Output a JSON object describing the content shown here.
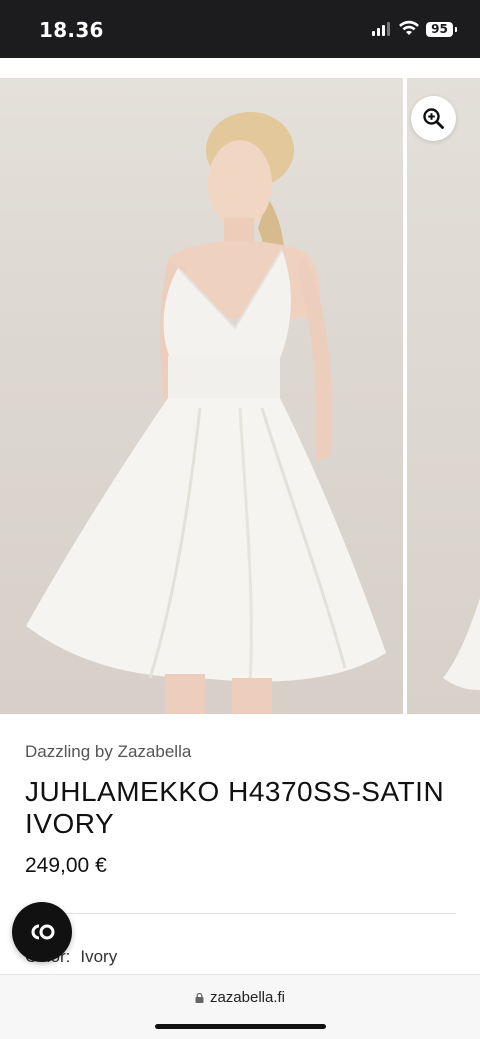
{
  "status_bar": {
    "time": "18.36",
    "battery": "95",
    "icons": [
      "signal-icon",
      "wifi-icon",
      "battery-icon"
    ]
  },
  "gallery": {
    "zoom_icon": "zoom-in-icon",
    "slides": [
      "product-photo-main",
      "product-photo-next"
    ]
  },
  "product": {
    "brand": "Dazzling by Zazabella",
    "title": "JUHLAMEKKO H4370SS-SATIN IVORY",
    "price": "249,00 €",
    "color_label": "Color:",
    "color_value": "Ivory"
  },
  "chat": {
    "icon": "chat-logo-icon"
  },
  "browser": {
    "url": "zazabella.fi",
    "lock_icon": "lock-icon"
  },
  "colors": {
    "status_bar_bg": "#1c1c1e",
    "text_primary": "#111111",
    "text_muted": "#555555",
    "chat_button_bg": "#111111"
  }
}
